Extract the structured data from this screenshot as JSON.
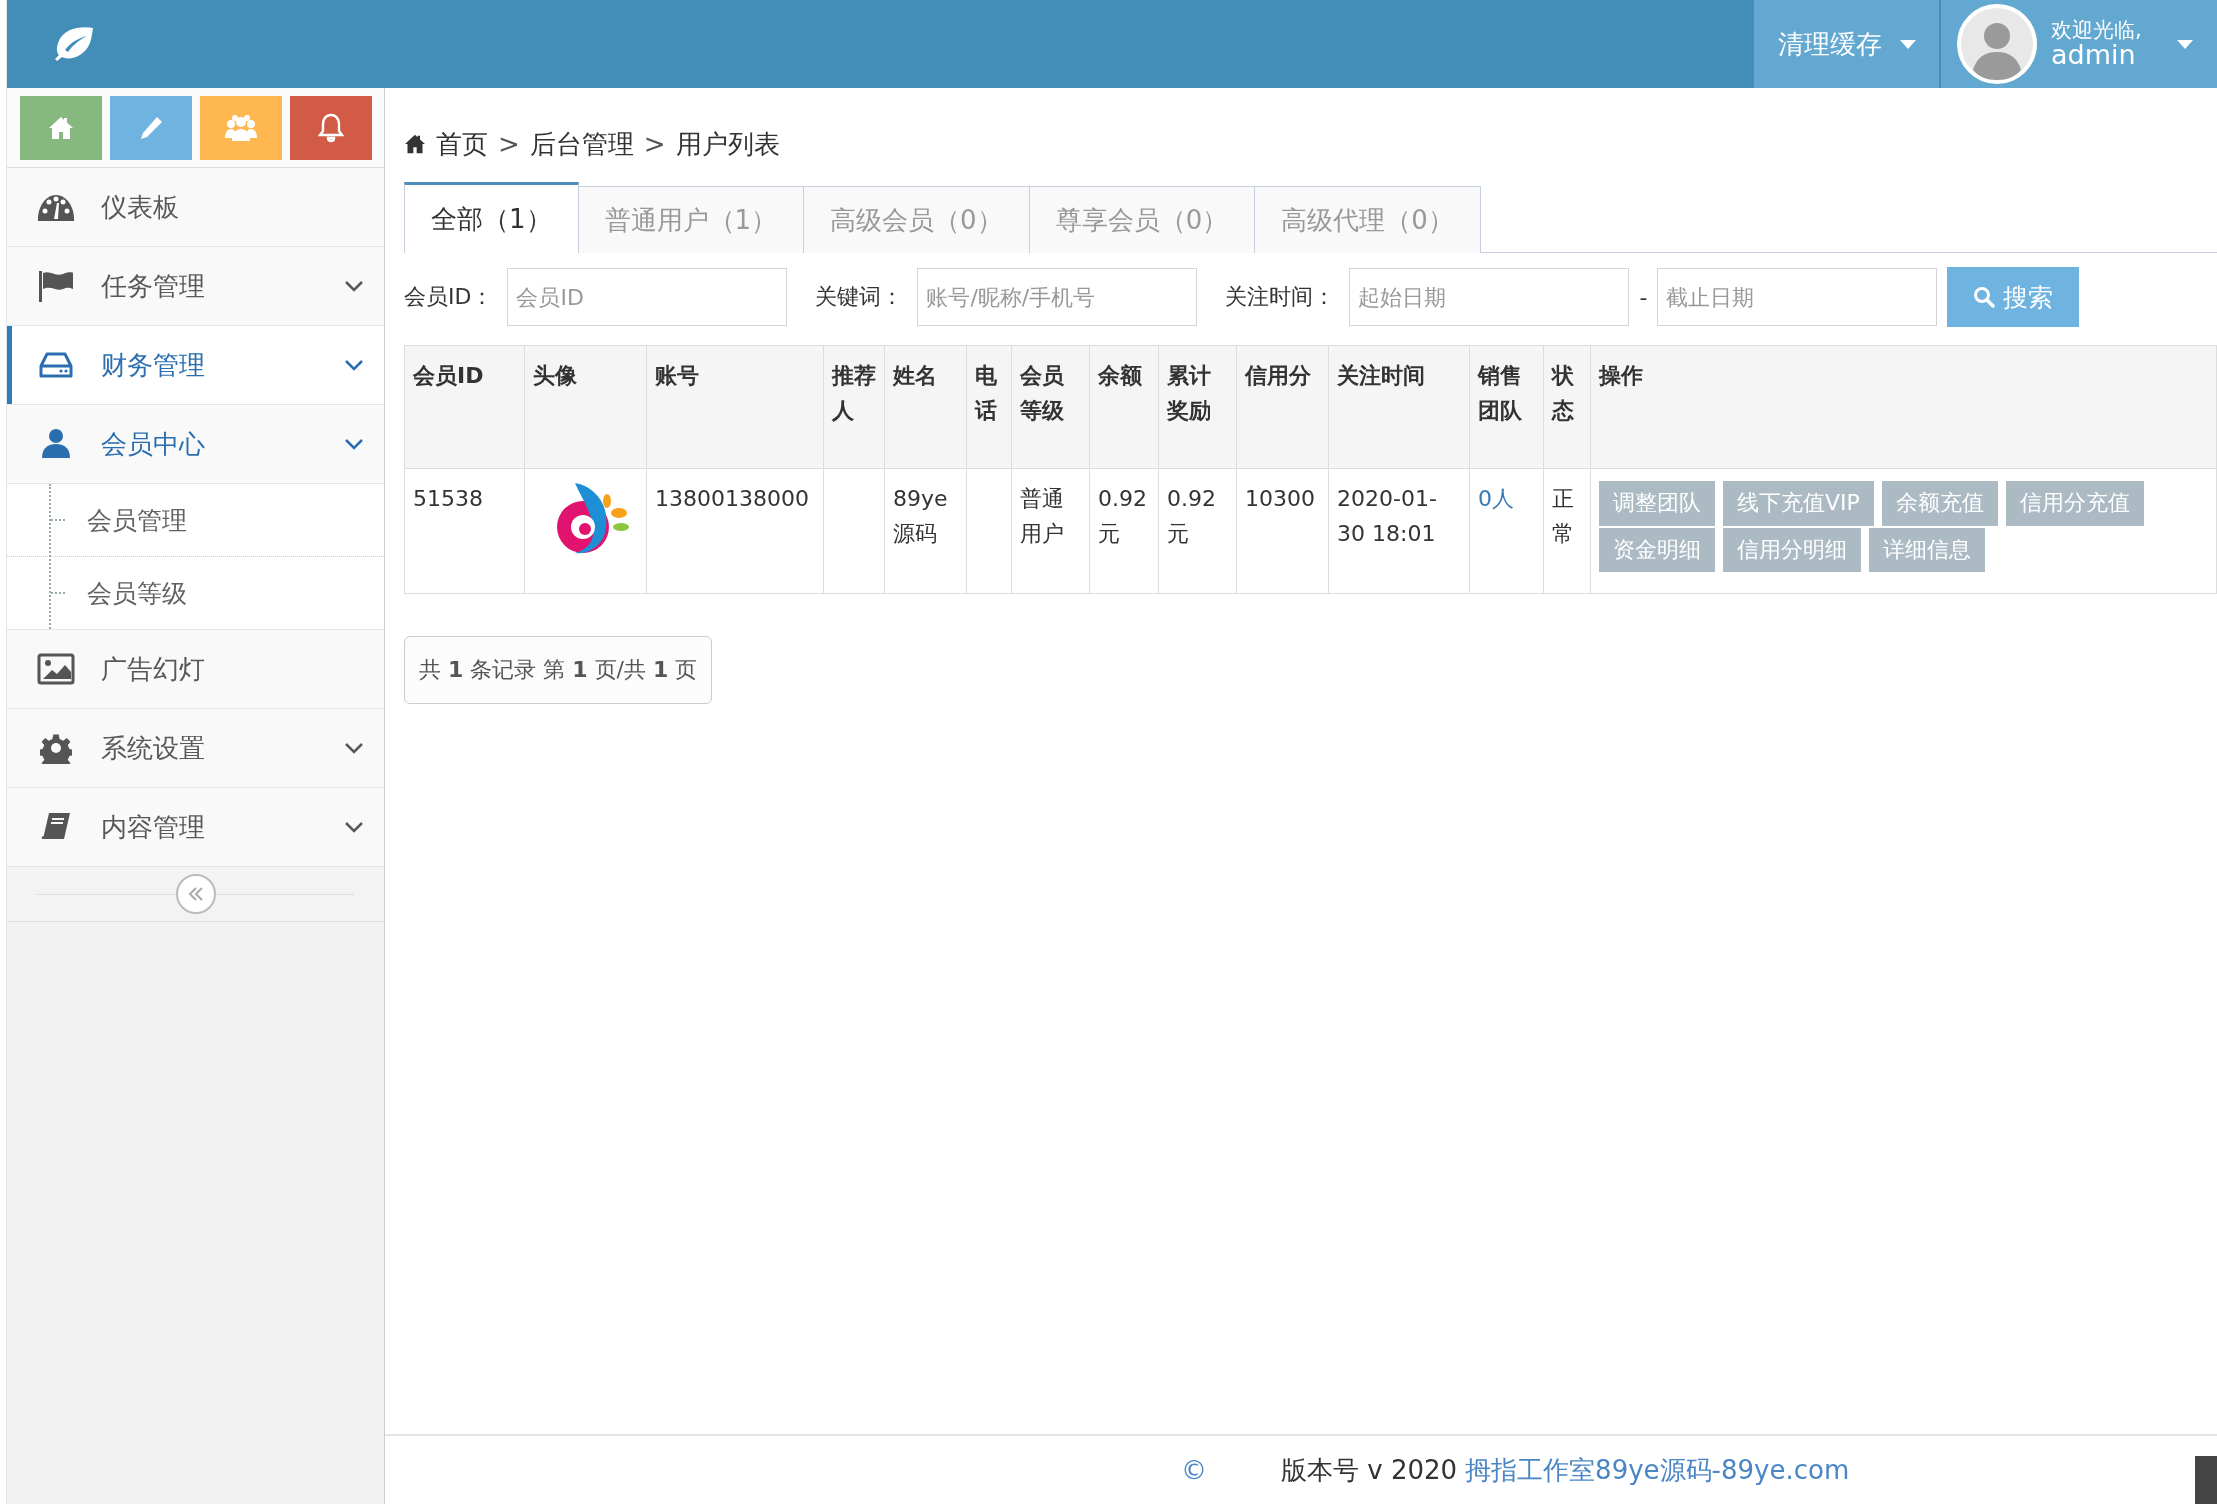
{
  "header": {
    "clear_cache": "清理缓存",
    "welcome": "欢迎光临,",
    "user": "admin"
  },
  "shortcuts": [
    {
      "color": "#87b87f"
    },
    {
      "color": "#6fb3e0"
    },
    {
      "color": "#ffb752"
    },
    {
      "color": "#d15b47"
    }
  ],
  "sidebar": {
    "items": [
      {
        "label": "仪表板",
        "kind": "link",
        "selected": false,
        "expanded": false
      },
      {
        "label": "任务管理",
        "kind": "group",
        "selected": false,
        "expanded": false
      },
      {
        "label": "财务管理",
        "kind": "group",
        "selected": true,
        "expanded": false
      },
      {
        "label": "会员中心",
        "kind": "group",
        "selected": false,
        "expanded": true,
        "children": [
          {
            "label": "会员管理"
          },
          {
            "label": "会员等级"
          }
        ]
      },
      {
        "label": "广告幻灯",
        "kind": "link",
        "selected": false,
        "expanded": false
      },
      {
        "label": "系统设置",
        "kind": "group",
        "selected": false,
        "expanded": false
      },
      {
        "label": "内容管理",
        "kind": "group",
        "selected": false,
        "expanded": false
      }
    ]
  },
  "breadcrumb": {
    "separator": ">",
    "items": [
      "首页",
      "后台管理",
      "用户列表"
    ]
  },
  "tabs": [
    {
      "label": "全部（1）",
      "selected": true
    },
    {
      "label": "普通用户（1）",
      "selected": false
    },
    {
      "label": "高级会员（0）",
      "selected": false
    },
    {
      "label": "尊享会员（0）",
      "selected": false
    },
    {
      "label": "高级代理（0）",
      "selected": false
    }
  ],
  "filters": {
    "fields": [
      {
        "label": "会员ID：",
        "placeholder": "会员ID"
      },
      {
        "label": "关键词：",
        "placeholder": "账号/昵称/手机号"
      },
      {
        "label": "关注时间：",
        "placeholder": "起始日期"
      },
      {
        "label": "-",
        "placeholder": "截止日期"
      }
    ],
    "search_button": "搜索"
  },
  "table": {
    "columns": [
      "会员ID",
      "头像",
      "账号",
      "推荐人",
      "姓名",
      "电话",
      "会员等级",
      "余额",
      "累计奖励",
      "信用分",
      "关注时间",
      "销售团队",
      "状态",
      "操作"
    ],
    "rows": [
      {
        "cells": [
          {
            "kind": "text",
            "text": "51538"
          },
          {
            "kind": "picture"
          },
          {
            "kind": "text",
            "text": "13800138000"
          },
          {
            "kind": "empty"
          },
          {
            "kind": "text",
            "text": "89ye源码"
          },
          {
            "kind": "empty"
          },
          {
            "kind": "text",
            "text": "普通用户"
          },
          {
            "kind": "text",
            "text": "0.92元"
          },
          {
            "kind": "text",
            "text": "0.92元"
          },
          {
            "kind": "text",
            "text": "10300"
          },
          {
            "kind": "text",
            "text": "2020-01-30 18:01"
          },
          {
            "kind": "link",
            "text": "0人"
          },
          {
            "kind": "text",
            "text": "正常"
          },
          {
            "kind": "actions",
            "buttons": [
              "调整团队",
              "线下充值VIP",
              "余额充值",
              "信用分充值",
              "资金明细",
              "信用分明细",
              "详细信息"
            ]
          }
        ]
      }
    ]
  },
  "pagination": "共 **1** 条记录 第 **1** 页/共 **1** 页",
  "footer": {
    "copyright": "©",
    "version": "版本号 v 2020",
    "link": "拇指工作室89ye源码-89ye.com"
  }
}
